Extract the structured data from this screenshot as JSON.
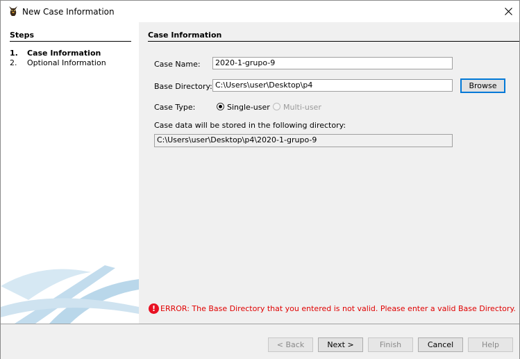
{
  "window": {
    "title": "New Case Information",
    "icon": "autopsy-dog-icon",
    "close_icon": "close-icon"
  },
  "sidebar": {
    "heading": "Steps",
    "steps": [
      {
        "num": "1.",
        "label": "Case Information",
        "current": true
      },
      {
        "num": "2.",
        "label": "Optional Information",
        "current": false
      }
    ]
  },
  "form": {
    "heading": "Case Information",
    "case_name": {
      "label": "Case Name:",
      "value": "2020-1-grupo-9"
    },
    "base_directory": {
      "label": "Base Directory:",
      "value": "C:\\Users\\user\\Desktop\\p4",
      "browse_label": "Browse"
    },
    "case_type": {
      "label": "Case Type:",
      "options": [
        {
          "label": "Single-user",
          "selected": true,
          "enabled": true
        },
        {
          "label": "Multi-user",
          "selected": false,
          "enabled": false
        }
      ]
    },
    "storage_label": "Case data will be stored in the following directory:",
    "storage_path": "C:\\Users\\user\\Desktop\\p4\\2020-1-grupo-9",
    "error": {
      "icon": "error-icon",
      "text": "ERROR: The Base Directory that you entered is not valid. Please enter a valid Base Directory."
    }
  },
  "buttons": {
    "back": "< Back",
    "next": "Next >",
    "finish": "Finish",
    "cancel": "Cancel",
    "help": "Help"
  },
  "colors": {
    "error": "#e00000",
    "focus": "#0078d7",
    "swoosh": "#b9d7ea"
  }
}
